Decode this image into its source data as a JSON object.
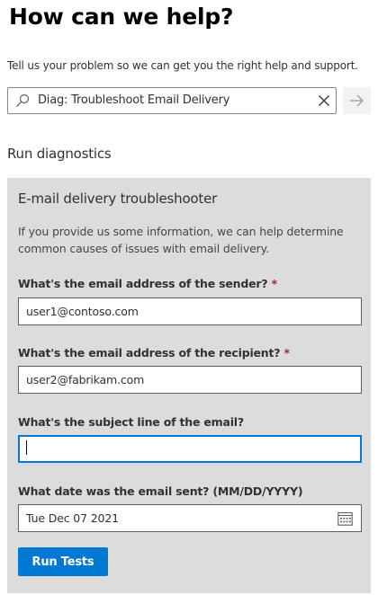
{
  "header": {
    "title": "How can we help?",
    "subtitle": "Tell us your problem so we can get you the right help and support."
  },
  "search": {
    "value": "Diag: Troubleshoot Email Delivery"
  },
  "section": {
    "title": "Run diagnostics"
  },
  "troubleshooter": {
    "title": "E-mail delivery troubleshooter",
    "description": "If you provide us some information, we can help determine common causes of issues with email delivery.",
    "fields": {
      "sender": {
        "label": "What's the email address of the sender?",
        "required_mark": "*",
        "value": "user1@contoso.com"
      },
      "recipient": {
        "label": "What's the email address of the recipient?",
        "required_mark": "*",
        "value": "user2@fabrikam.com"
      },
      "subject": {
        "label": "What's the subject line of the email?",
        "value": ""
      },
      "date": {
        "label": "What date was the email sent? (MM/DD/YYYY)",
        "value": "Tue Dec 07 2021"
      }
    },
    "run_label": "Run Tests"
  },
  "colors": {
    "accent": "#0078d4",
    "required": "#a4262c",
    "panel": "#dcdcdc"
  }
}
